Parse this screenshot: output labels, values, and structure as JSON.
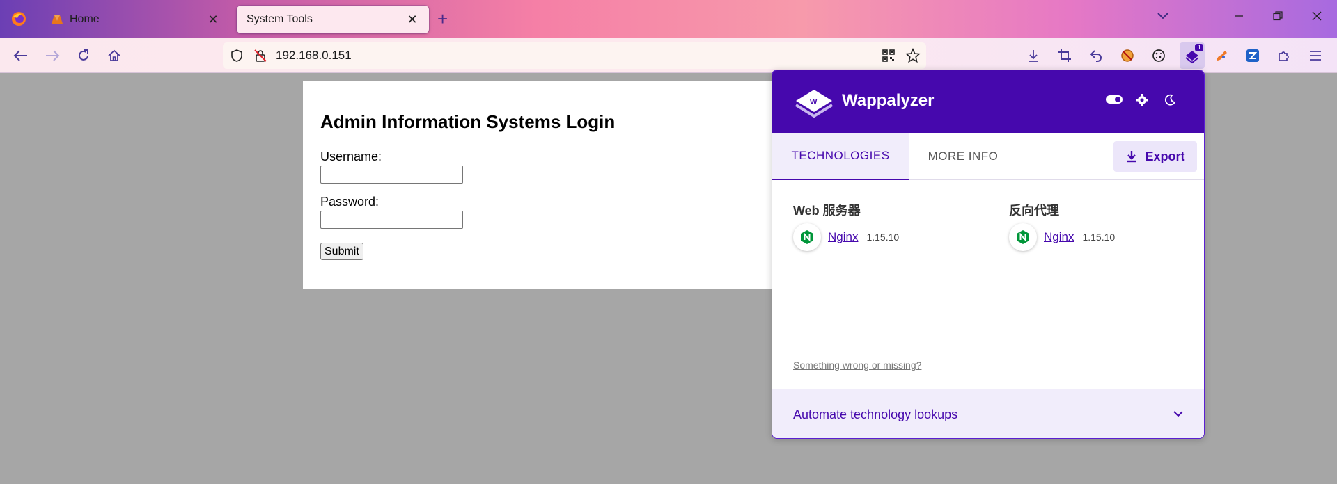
{
  "browser": {
    "tabs": [
      {
        "title": "Home"
      },
      {
        "title": "System Tools"
      }
    ],
    "url": "192.168.0.151",
    "icons": {
      "back": "arrow-left-icon",
      "forward": "arrow-right-icon",
      "reload": "reload-icon",
      "home": "home-icon",
      "tracking": "shield-icon",
      "insecure": "lock-off-icon",
      "qr": "qr-icon",
      "bookmark": "star-icon"
    },
    "extension_badge": "1"
  },
  "login": {
    "heading": "Admin Information Systems Login",
    "username_label": "Username:",
    "password_label": "Password:",
    "username_value": "",
    "password_value": "",
    "submit_label": "Submit"
  },
  "wappalyzer": {
    "title": "Wappalyzer",
    "tabs": [
      "TECHNOLOGIES",
      "MORE INFO"
    ],
    "export_label": "Export",
    "categories": [
      {
        "name": "Web 服务器",
        "tech": "Nginx",
        "version": "1.15.10"
      },
      {
        "name": "反向代理",
        "tech": "Nginx",
        "version": "1.15.10"
      }
    ],
    "wrong_link": "Something wrong or missing?",
    "footer_label": "Automate technology lookups"
  },
  "colors": {
    "brand": "#4608ad",
    "nginx_green": "#009639"
  }
}
